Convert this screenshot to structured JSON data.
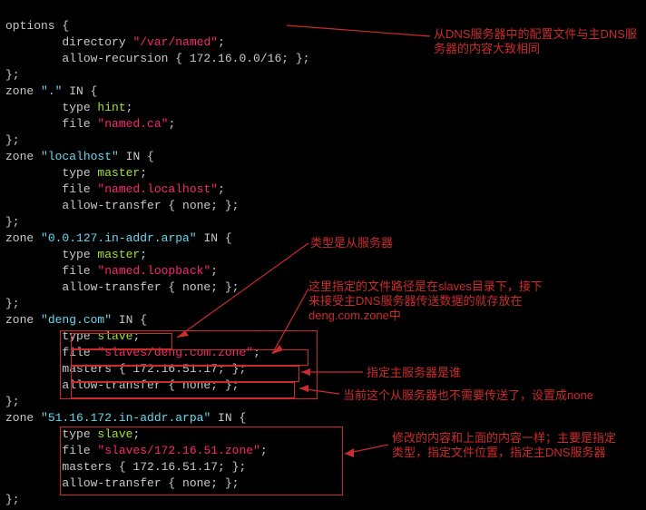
{
  "code": {
    "l0": "options {",
    "l1": "        directory",
    "l1s": "\"/var/named\"",
    "l1e": ";",
    "l2": "        allow-recursion { 172.16.0.0/16; };",
    "l3": "};",
    "l4a": "zone ",
    "l4b": "\".\"",
    "l4c": " IN {",
    "l5": "        type ",
    "l5v": "hint",
    "l5e": ";",
    "l6": "        file ",
    "l6v": "\"named.ca\"",
    "l6e": ";",
    "l7": "};",
    "l8a": "zone ",
    "l8b": "\"localhost\"",
    "l8c": " IN {",
    "l9": "        type ",
    "l9v": "master",
    "l9e": ";",
    "l10": "        file ",
    "l10v": "\"named.localhost\"",
    "l10e": ";",
    "l11": "        allow-transfer { none; };",
    "l12": "};",
    "l13a": "zone ",
    "l13b": "\"0.0.127.in-addr.arpa\"",
    "l13c": " IN {",
    "l14": "        type ",
    "l14v": "master",
    "l14e": ";",
    "l15": "        file ",
    "l15v": "\"named.loopback\"",
    "l15e": ";",
    "l16": "        allow-transfer { none; };",
    "l17": "};",
    "l18a": "zone ",
    "l18b": "\"deng.com\"",
    "l18c": " IN {",
    "l19": "        type ",
    "l19v": "slave",
    "l19e": ";",
    "l20": "        file ",
    "l20v": "\"slaves/deng.com.zone\"",
    "l20e": ";",
    "l21": "        masters { 172.16.51.17; };",
    "l22": "        allow-transfer { none; };",
    "l23": "};",
    "l24a": "zone ",
    "l24b": "\"51.16.172.in-addr.arpa\"",
    "l24c": " IN {",
    "l25": "        type ",
    "l25v": "slave",
    "l25e": ";",
    "l26": "        file ",
    "l26v": "\"slaves/172.16.51.zone\"",
    "l26e": ";",
    "l27": "        masters { 172.16.51.17; };",
    "l28": "        allow-transfer { none; };",
    "l29": "};"
  },
  "ann": {
    "a1": "从DNS服务器中的配置文件与主DNS服务器的内容大致相同",
    "a2": "类型是从服务器",
    "a3": "这里指定的文件路径是在slaves目录下，接下来接受主DNS服务器传送数据的就存放在deng.com.zone中",
    "a4": "指定主服务器是谁",
    "a5": "当前这个从服务器也不需要传送了，设置成none",
    "a6": "修改的内容和上面的内容一样；主要是指定类型，指定文件位置，指定主DNS服务器"
  }
}
